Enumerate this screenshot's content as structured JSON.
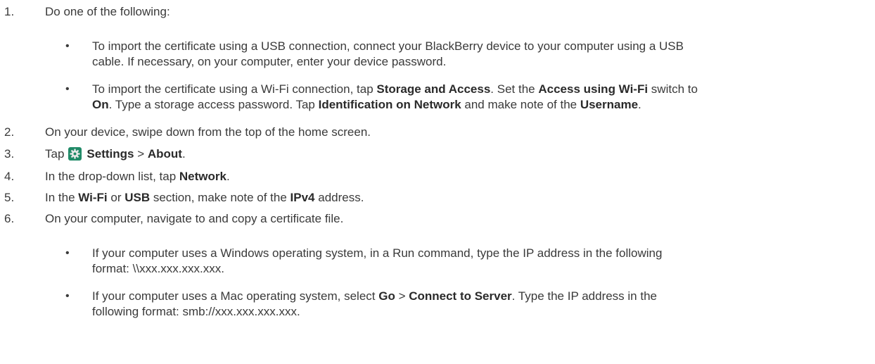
{
  "steps": [
    {
      "num": "1.",
      "text": "Do one of the following:"
    },
    {
      "num": "2.",
      "text": "On your device, swipe down from the top of the home screen."
    },
    {
      "num": "3.",
      "pre": "Tap",
      "b1": "Settings",
      "sep": " > ",
      "b2": "About",
      "post": "."
    },
    {
      "num": "4.",
      "pre": "In the drop-down list, tap ",
      "b1": "Network",
      "post": "."
    },
    {
      "num": "5.",
      "pre": "In the ",
      "b1": "Wi-Fi",
      "mid1": " or ",
      "b2": "USB",
      "mid2": " section, make note of the ",
      "b3": "IPv4",
      "post": " address."
    },
    {
      "num": "6.",
      "text": "On your computer, navigate to and copy a certificate file."
    }
  ],
  "bullets_step1": {
    "usb": {
      "line1": "To import the certificate using a USB connection, connect your BlackBerry device to your computer using a USB",
      "line2": "cable. If necessary, on your computer, enter your device password."
    },
    "wifi": {
      "l1_pre": "To import the certificate using a Wi-Fi connection, tap ",
      "l1_b1": "Storage and Access",
      "l1_mid": ". Set the ",
      "l1_b2": "Access using Wi-Fi",
      "l1_post": " switch to",
      "l2_b1": "On",
      "l2_mid1": ". Type a storage access password. Tap ",
      "l2_b2": "Identification on Network",
      "l2_mid2": " and make note of the ",
      "l2_b3": "Username",
      "l2_post": "."
    }
  },
  "bullets_step6": {
    "windows": {
      "line1": "If your computer uses a Windows operating system, in a Run command, type the IP address in the following",
      "line2": "format: \\\\xxx.xxx.xxx.xxx."
    },
    "mac": {
      "l1_pre": "If your computer uses a Mac operating system, select ",
      "l1_b1": "Go",
      "l1_sep": " > ",
      "l1_b2": "Connect to Server",
      "l1_post": ". Type the IP address in the",
      "line2": "following format: smb://xxx.xxx.xxx.xxx."
    }
  },
  "icons": {
    "settings": "gear-icon",
    "settings_color": "#1f8a67"
  }
}
